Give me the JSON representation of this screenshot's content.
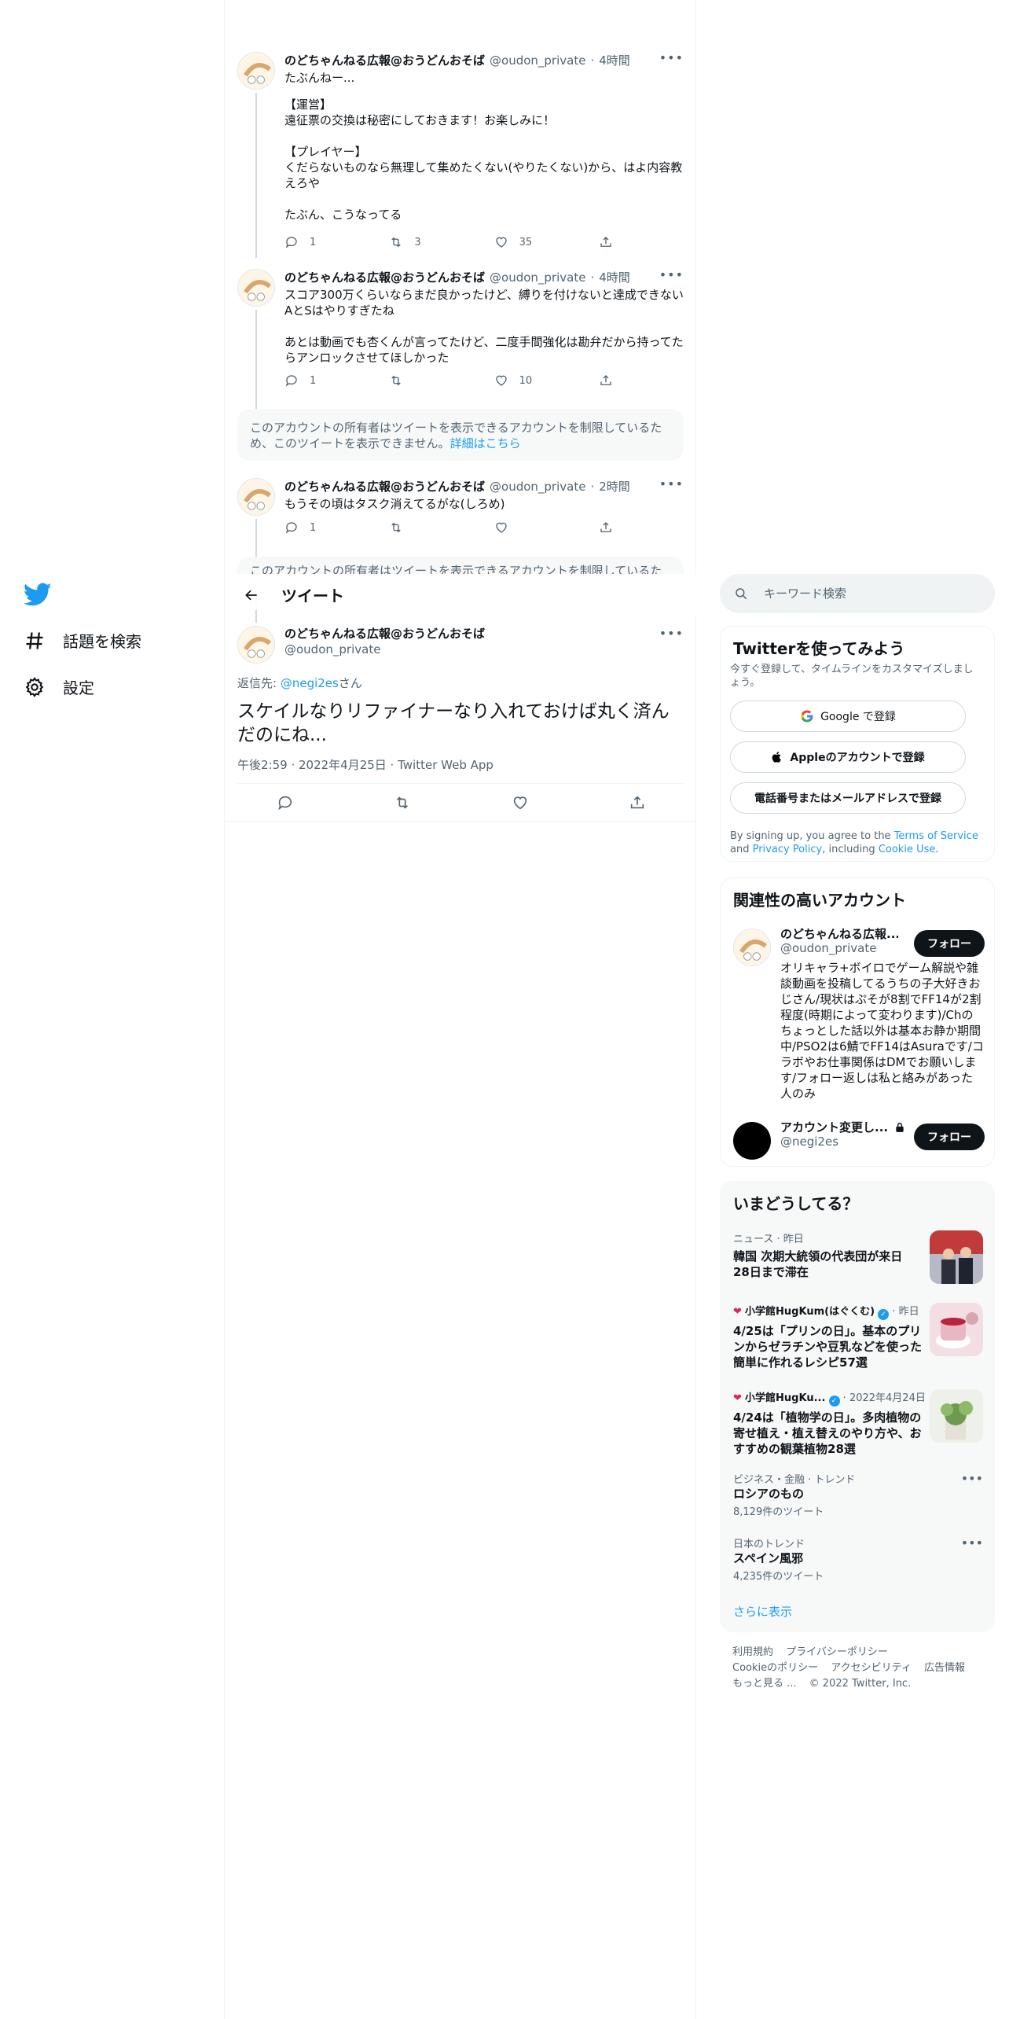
{
  "nav": {
    "explore_label": "話題を検索",
    "settings_label": "設定"
  },
  "thread": [
    {
      "name": "のどちゃんねる広報@おうどんおそば",
      "handle": "@oudon_private",
      "time": "4時間",
      "text": "たぶんねー...\n",
      "quote": "【運営】\n遠征票の交換は秘密にしておきます！お楽しみに！\n\n【プレイヤー】\nくだらないものなら無理して集めたくない(やりたくない)から、はよ内容教えろや\n\nたぶん、こうなってる",
      "replies": "1",
      "retweets": "3",
      "likes": "35"
    },
    {
      "name": "のどちゃんねる広報@おうどんおそば",
      "handle": "@oudon_private",
      "time": "4時間",
      "text": "スコア300万くらいならまだ良かったけど、縛りを付けないと達成できないAとSはやりすぎたね\n\nあとは動画でも杏くんが言ってたけど、二度手間強化は勘弁だから持ってたらアンロックさせてほしかった",
      "replies": "1",
      "retweets": "",
      "likes": "10"
    },
    {
      "name": "のどちゃんねる広報@おうどんおそば",
      "handle": "@oudon_private",
      "time": "2時間",
      "text": "もうその頃はタスク消えてるがな(しろめ)",
      "replies": "1",
      "retweets": "",
      "likes": ""
    }
  ],
  "restricted": {
    "text": "このアカウントの所有者はツイートを表示できるアカウントを制限しているため、このツイートを表示できません。",
    "link": "詳細はこちら",
    "text_partial": "このアカウントの所有者はツイートを表示できるアカウントを制限しているた"
  },
  "header": {
    "title": "ツイート"
  },
  "focus_tweet": {
    "name": "のどちゃんねる広報@おうどんおそば",
    "handle": "@oudon_private",
    "reply_prefix": "返信先: ",
    "reply_handle": "@negi2es",
    "reply_suffix": "さん",
    "text": "スケイルなりリファイナーなり入れておけば丸く済んだのにね...",
    "meta": "午後2:59 · 2022年4月25日 · Twitter Web App"
  },
  "search": {
    "placeholder": "キーワード検索"
  },
  "signup": {
    "title": "Twitterを使ってみよう",
    "subtitle": "今すぐ登録して、タイムラインをカスタマイズしましょう。",
    "google": "Google で登録",
    "apple": "Appleのアカウントで登録",
    "phone": "電話番号またはメールアドレスで登録",
    "legal_1": "By signing up, you agree to the ",
    "legal_tos": "Terms of Service",
    "legal_2": " and ",
    "legal_privacy": "Privacy Policy",
    "legal_3": ", including ",
    "legal_cookie": "Cookie Use",
    "legal_4": "."
  },
  "related": {
    "title": "関連性の高いアカウント",
    "accounts": [
      {
        "name": "のどちゃんねる広報...",
        "handle": "@oudon_private",
        "bio": "オリキャラ+ボイロでゲーム解説や雑談動画を投稿してるうちの子大好きおじさん/現状はぷそが8割でFF14が2割程度(時期によって変わります)/Chのちょっとした話以外は基本お静か期間中/PSO2は6鯖でFF14はAsuraです/コラボやお仕事関係はDMでお願いします/フォロー返しは私と絡みがあった人のみ",
        "follow": "フォロー"
      },
      {
        "name": "アカウント変更し...",
        "handle": "@negi2es",
        "follow": "フォロー"
      }
    ]
  },
  "trends": {
    "title": "いまどうしてる？",
    "items": [
      {
        "meta": "ニュース · 昨日",
        "title": "韓国 次期大統領の代表団が来日 28日まで滞在"
      },
      {
        "meta_source": "小学館HugKum(はぐくむ)",
        "meta_time": " · 昨日",
        "title": "4/25は「プリンの日」。基本のプリンからゼラチンや豆乳などを使った簡単に作れるレシピ57選"
      },
      {
        "meta_source": "小学館HugKu...",
        "meta_time": " · 2022年4月24日",
        "title": "4/24は「植物学の日」。多肉植物の寄せ植え・植え替えのやり方や、おすすめの観葉植物28選"
      },
      {
        "meta": "ビジネス・金融 · トレンド",
        "title": "ロシアのもの",
        "count": "8,129件のツイート"
      },
      {
        "meta": "日本のトレンド",
        "title": "スペイン風邪",
        "count": "4,235件のツイート"
      }
    ],
    "show_more": "さらに表示"
  },
  "footer": {
    "links": [
      "利用規約",
      "プライバシーポリシー",
      "Cookieのポリシー",
      "アクセシビリティ",
      "広告情報",
      "もっと見る ..."
    ],
    "copyright": "© 2022 Twitter, Inc."
  },
  "colors": {
    "accent": "#1d9bf0",
    "text": "#0f1419",
    "muted": "#536471",
    "button_dark": "#0f1419"
  }
}
